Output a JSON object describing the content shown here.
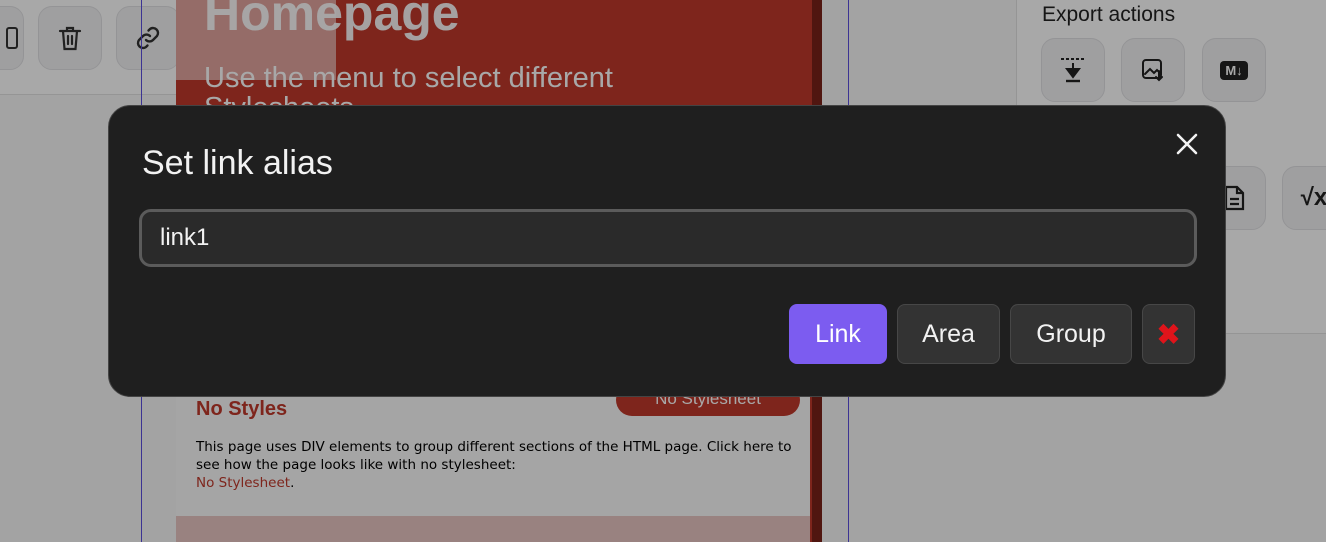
{
  "background": {
    "preview": {
      "heading": "Homepage",
      "subtitle_line1": "Use the menu to select different",
      "subtitle_line2": "Stylesheets",
      "section_title": "No Styles",
      "section_button": "No Stylesheet",
      "section_text": "This page uses DIV elements to group different sections of the HTML page. Click here to see how the page looks like with no stylesheet:",
      "section_link": "No Stylesheet",
      "section_link_suffix": "."
    },
    "left_toolbar": {
      "icons": [
        "partial-icon",
        "trash-icon",
        "link-icon"
      ]
    },
    "right_panel": {
      "title": "Export actions",
      "icons": [
        "save-to-file-icon",
        "export-image-icon",
        "markdown-icon",
        "document-icon",
        "math-icon"
      ],
      "markdown_label": "M↓",
      "math_label": "√x"
    }
  },
  "dialog": {
    "title": "Set link alias",
    "input_value": "link1",
    "buttons": {
      "link": "Link",
      "area": "Area",
      "group": "Group"
    },
    "delete_glyph": "✖",
    "colors": {
      "primary": "#7c5cf0",
      "delete": "#e0141b",
      "background": "#1f1f1f"
    }
  }
}
